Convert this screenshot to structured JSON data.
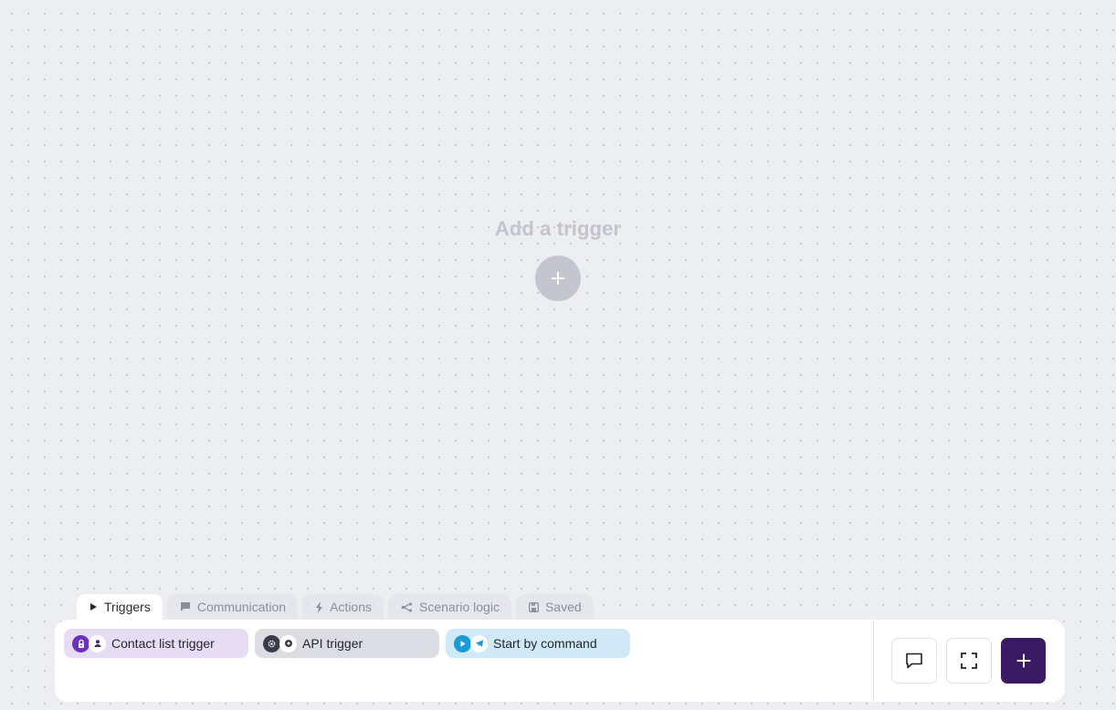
{
  "canvas": {
    "empty_title": "Add a trigger",
    "add_button_icon": "plus-icon"
  },
  "tabs": [
    {
      "label": "Triggers",
      "icon": "play-icon",
      "active": true
    },
    {
      "label": "Communication",
      "icon": "chat-bubble-icon",
      "active": false
    },
    {
      "label": "Actions",
      "icon": "lightning-icon",
      "active": false
    },
    {
      "label": "Scenario logic",
      "icon": "branch-icon",
      "active": false
    },
    {
      "label": "Saved",
      "icon": "save-icon",
      "active": false
    }
  ],
  "triggers": [
    {
      "label": "Contact list trigger",
      "color": "#e6dcf4",
      "icons": [
        "lock-icon",
        "person-icon"
      ]
    },
    {
      "label": "API trigger",
      "color": "#dcdde3",
      "icons": [
        "gear-icon",
        "target-icon"
      ]
    },
    {
      "label": "Start by command",
      "color": "#cfe9f7",
      "icons": [
        "play-circle-icon",
        "telegram-icon"
      ]
    }
  ],
  "toolbar": {
    "comment_icon": "comment-icon",
    "fullscreen_icon": "fullscreen-icon",
    "add_icon": "plus-icon"
  },
  "colors": {
    "accent": "#3a1a63",
    "purple_chip": "#6d2fc0",
    "blue_chip": "#1a9ad6",
    "gray_chip": "#3a3c4a"
  }
}
